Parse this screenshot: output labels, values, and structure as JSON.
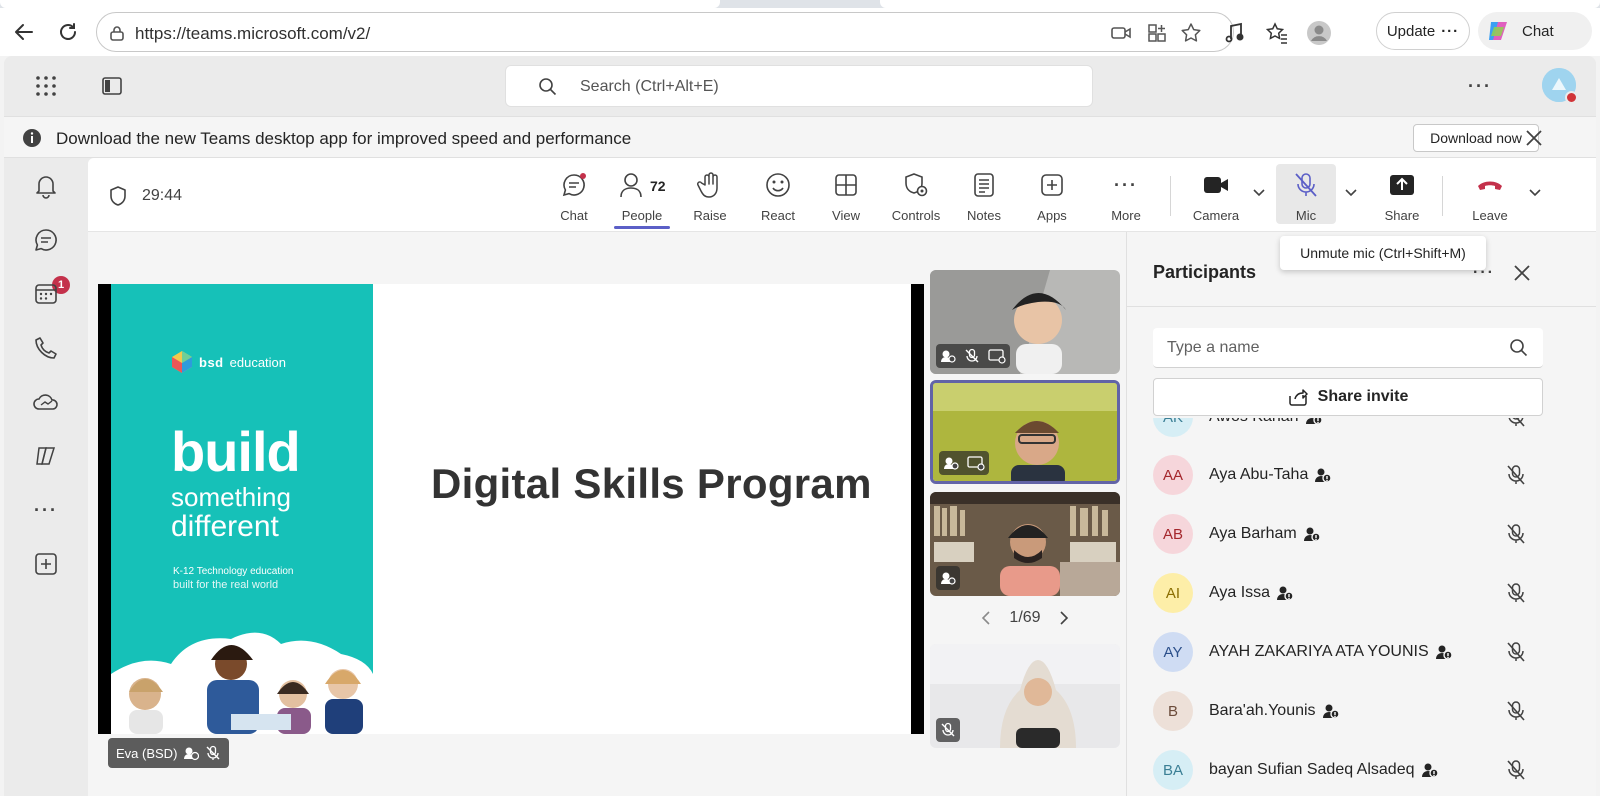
{
  "browser": {
    "url": "https://teams.microsoft.com/v2/",
    "update_label": "Update",
    "copilot_label": "Chat"
  },
  "teams": {
    "search_placeholder": "Search (Ctrl+Alt+E)",
    "banner": {
      "message": "Download the new Teams desktop app for improved speed and performance",
      "action": "Download now"
    },
    "rail": {
      "chat_badge": "1"
    },
    "meeting": {
      "timer": "29:44",
      "toolbar": {
        "chat": "Chat",
        "people": "People",
        "people_count": "72",
        "raise": "Raise",
        "react": "React",
        "view": "View",
        "controls": "Controls",
        "notes": "Notes",
        "apps": "Apps",
        "more": "More",
        "camera": "Camera",
        "mic": "Mic",
        "share": "Share",
        "leave": "Leave"
      },
      "tooltip": "Unmute mic (Ctrl+Shift+M)",
      "slide": {
        "brand_name": "bsd",
        "brand_suffix": "education",
        "headline_1": "build",
        "headline_2": "something",
        "headline_3": "different",
        "tagline_1": "K-12 Technology education",
        "tagline_2": "built for the real world",
        "title": "Digital Skills Program"
      },
      "presenter_name": "Eva (BSD)",
      "pager": "1/69",
      "colors": {
        "accent": "#5b5fc7",
        "slide_teal": "#16c1b8",
        "leave_red": "#c4314b"
      }
    },
    "participants": {
      "title": "Participants",
      "search_placeholder": "Type a name",
      "share_invite": "Share invite",
      "items": [
        {
          "initials": "AK",
          "name": "Awos Kanan",
          "bg": "#d6eef5",
          "fg": "#3b7f95"
        },
        {
          "initials": "AA",
          "name": "Aya Abu-Taha",
          "bg": "#f6d6db",
          "fg": "#a4262c"
        },
        {
          "initials": "AB",
          "name": "Aya Barham",
          "bg": "#f6d6db",
          "fg": "#a4262c"
        },
        {
          "initials": "AI",
          "name": "Aya Issa",
          "bg": "#fdeea8",
          "fg": "#8a6d00"
        },
        {
          "initials": "AY",
          "name": "AYAH ZAKARIYA ATA YOUNIS",
          "bg": "#cfdcf3",
          "fg": "#2b4f8a"
        },
        {
          "initials": "B",
          "name": "Bara'ah.Younis",
          "bg": "#ede0d8",
          "fg": "#6b4b3a"
        },
        {
          "initials": "BA",
          "name": "bayan Sufian Sadeq Alsadeq",
          "bg": "#d6eef5",
          "fg": "#3b7f95"
        }
      ]
    }
  }
}
